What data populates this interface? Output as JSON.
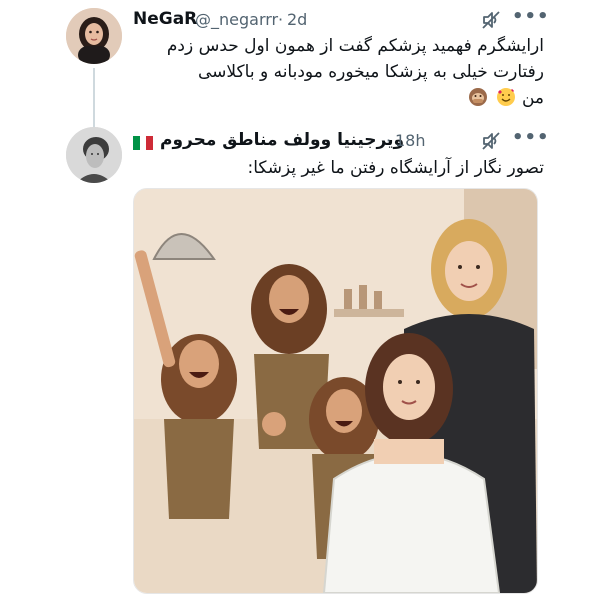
{
  "tweet1": {
    "name": "NeGaR",
    "handle": "@_negarrr",
    "dot": "·",
    "time": "2d",
    "lines": [
      "ارایشگرم فهمید پزشکم گفت از همون اول حدس زدم",
      "رفتارت خیلی به پزشکا میخوره مودبانه و باکلاسی",
      "من"
    ],
    "emoji_icons": [
      "smiling-face-with-hearts-icon",
      "monkey-covering-mouth-icon"
    ]
  },
  "tweet2": {
    "name": "ويرجينيا وولف مناطق محروم",
    "flag_icon": "italy-flag-icon",
    "dot": "·",
    "time": "18h",
    "text": "تصور نگار از آرایشگاه رفتن ما غیر پزشکا:",
    "media_icon": "cartoon-salon-image"
  },
  "actions": {
    "more_label": "•••",
    "mute_icon": "no-sound-icon"
  },
  "colors": {
    "text": "#0f1419",
    "secondary": "#536471",
    "thread_line": "#cfd9de"
  }
}
